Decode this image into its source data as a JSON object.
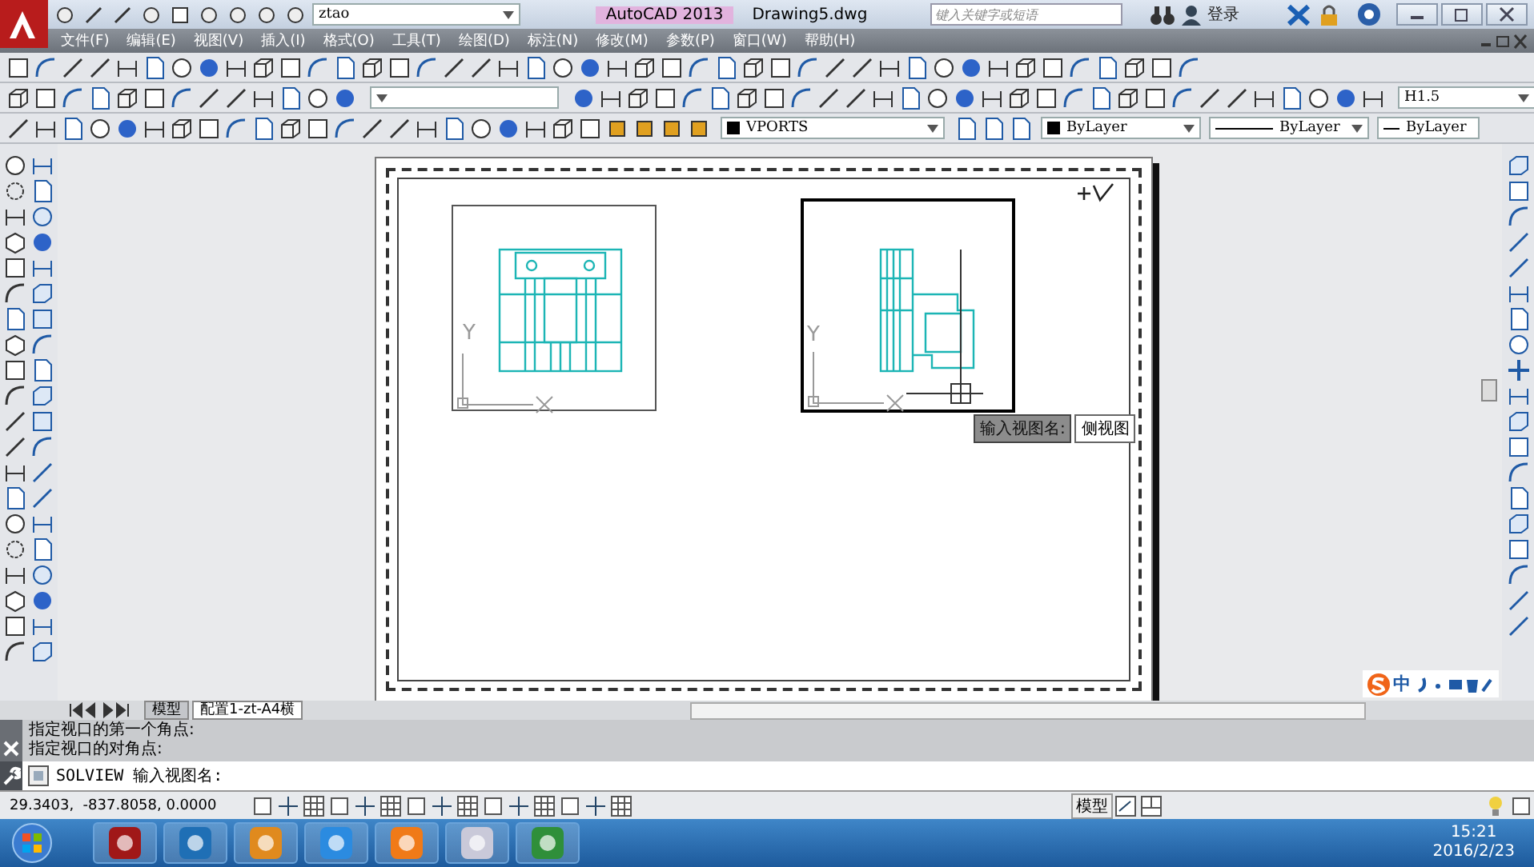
{
  "title_bar": {
    "workspace": "ztao",
    "app": "AutoCAD 2013",
    "file": "Drawing5.dwg",
    "search_placeholder": "键入关键字或短语",
    "login": "登录"
  },
  "menu": [
    "文件(F)",
    "编辑(E)",
    "视图(V)",
    "插入(I)",
    "格式(O)",
    "工具(T)",
    "绘图(D)",
    "标注(N)",
    "修改(M)",
    "参数(P)",
    "窗口(W)",
    "帮助(H)"
  ],
  "toolbars": {
    "style_combo": "H1.5",
    "layer_combo": "VPORTS",
    "color_combo": "ByLayer",
    "linetype_combo": "ByLayer",
    "lineweight_combo": "ByLayer"
  },
  "drawing": {
    "viewports": [
      {
        "ucs_label": "Y",
        "selected": false
      },
      {
        "ucs_label": "Y",
        "selected": true
      }
    ],
    "prompt_tooltip": {
      "label": "输入视图名:",
      "value": "侧视图"
    }
  },
  "layout_tabs": [
    {
      "label": "模型",
      "selected": false
    },
    {
      "label": "配置1-zt-A4横",
      "selected": true
    }
  ],
  "command": {
    "history": [
      "指定视口的第一个角点:",
      "指定视口的对角点:"
    ],
    "prompt": "SOLVIEW 输入视图名:"
  },
  "status_bar": {
    "coordinates": "29.3403,  -837.8058, 0.0000",
    "space": "模型"
  },
  "ime_bar": {
    "mode": "中"
  },
  "taskbar": {
    "time": "15:21",
    "date": "2016/2/23"
  }
}
